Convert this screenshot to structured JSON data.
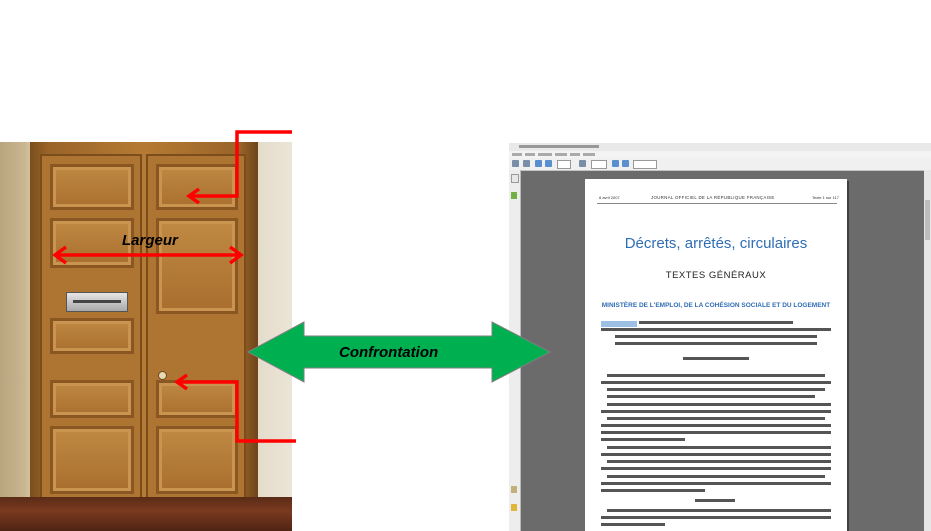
{
  "labels": {
    "largeur": "Largeur",
    "confrontation": "Confrontation"
  },
  "colors": {
    "red_arrow": "#ff0000",
    "green_arrow": "#00b050",
    "title_blue": "#2f6db5"
  },
  "pdf_document": {
    "header_left": "8 avril 2007",
    "header_center": "JOURNAL OFFICIEL DE LA RÉPUBLIQUE FRANÇAISE",
    "header_right": "Texte 1 sur 117",
    "title": "Décrets, arrêtés, circulaires",
    "subtitle": "TEXTES GÉNÉRAUX",
    "ministry": "MINISTÈRE DE L'EMPLOI, DE LA COHÉSION SOCIALE ET DU LOGEMENT"
  }
}
